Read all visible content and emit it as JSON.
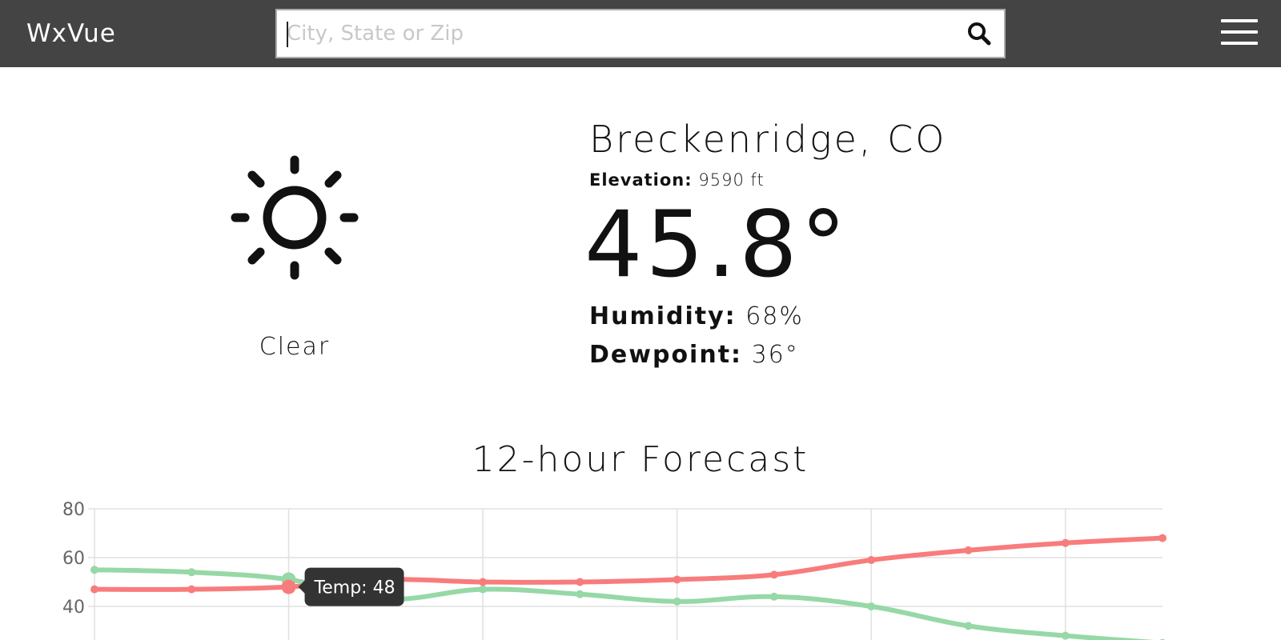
{
  "app": {
    "title": "WxVue"
  },
  "search": {
    "placeholder": "City, State or Zip",
    "value": "",
    "icon": "search-icon"
  },
  "menu": {
    "icon": "hamburger-menu-icon"
  },
  "current": {
    "icon": "sun-icon",
    "condition": "Clear",
    "location": "Breckenridge, CO",
    "elevation_label": "Elevation:",
    "elevation_value": "9590 ft",
    "temperature": "45.8°",
    "humidity_label": "Humidity:",
    "humidity_value": "68%",
    "dewpoint_label": "Dewpoint:",
    "dewpoint_value": "36°"
  },
  "forecast": {
    "title": "12-hour Forecast",
    "tooltip": "Temp: 48"
  },
  "colors": {
    "topbar": "#444444",
    "temp_series": "#f87c7c",
    "humidity_series": "#96d8a6",
    "tooltip_bg": "#333333"
  },
  "chart_data": {
    "type": "line",
    "y_ticks": [
      80,
      60,
      40
    ],
    "ylim": [
      27,
      81
    ],
    "grid": true,
    "series": [
      {
        "color": "#f87c7c",
        "values": [
          47,
          47,
          48,
          51,
          50,
          50,
          51,
          53,
          59,
          63,
          66,
          68
        ]
      },
      {
        "color": "#96d8a6",
        "values": [
          55,
          54,
          51,
          43,
          47,
          45,
          42,
          44,
          40,
          32,
          28,
          25
        ]
      }
    ],
    "active_point": {
      "series": 0,
      "index": 2
    }
  }
}
